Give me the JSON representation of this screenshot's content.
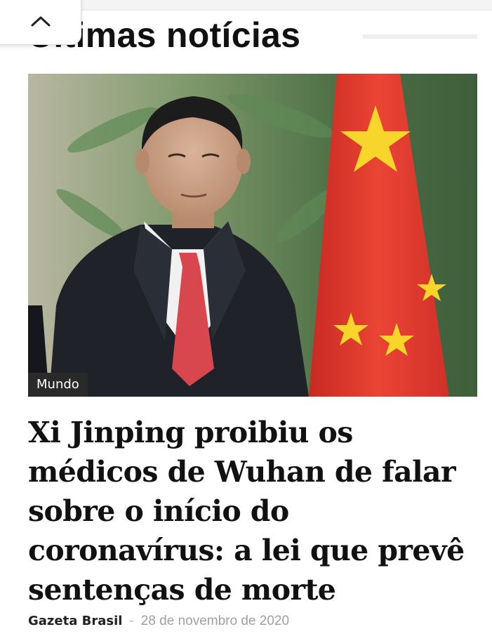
{
  "section": {
    "title": "Últimas notícias"
  },
  "article": {
    "category": "Mundo",
    "headline": "Xi Jinping proibiu os médicos de Wuhan de falar sobre o início do coronavírus: a lei que prevê sentenças de morte",
    "author": "Gazeta Brasil",
    "separator": "-",
    "date": "28 de novembro de 2020",
    "image_description_icon": "photo-icon"
  },
  "controls": {
    "collapse_icon": "chevron-up-icon"
  },
  "colors": {
    "flag_red": "#e23b2e",
    "flag_star": "#f7d52b",
    "badge_bg": "#2a2a2a",
    "headline": "#111111",
    "date": "#a0a0a0"
  }
}
